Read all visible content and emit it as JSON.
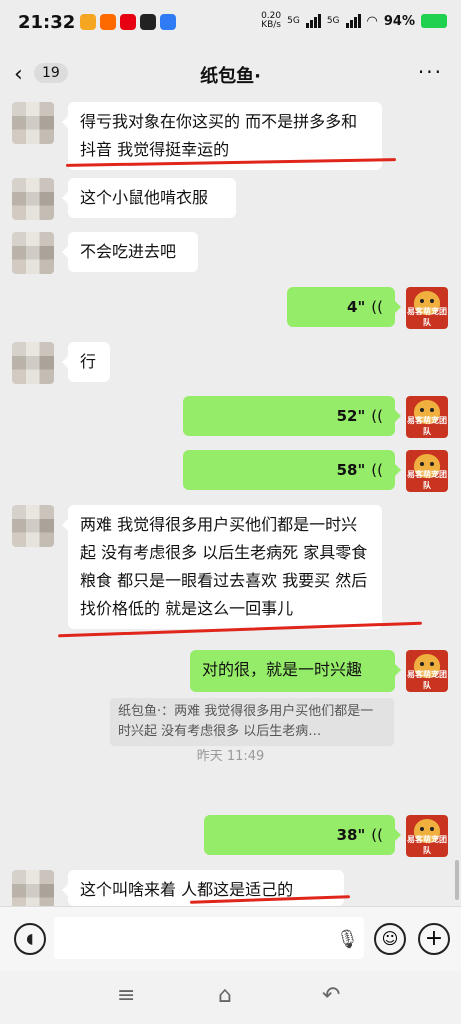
{
  "status": {
    "time": "21:32",
    "net_speed_top": "0.20",
    "net_speed_bottom": "KB/s",
    "signal1": "5G",
    "signal2": "5G",
    "battery": "94%"
  },
  "nav": {
    "back_count": "19",
    "title": "纸包鱼·"
  },
  "avatar_label": "易客萌宠团队",
  "messages": {
    "m1": "得亏我对象在你这买的  而不是拼多多和抖音   我觉得挺幸运的",
    "m2": "这个小鼠他啃衣服",
    "m3": "不会吃进去吧",
    "v1": "4\"",
    "m4": "行",
    "v2": "52\"",
    "v3": "58\"",
    "m5": "两难   我觉得很多用户买他们都是一时兴起   没有考虑很多   以后生老病死  家具零食粮食  都只是一眼看过去喜欢  我要买  然后找价格低的  就是这么一回事儿",
    "m6": "对的很，就是一时兴趣",
    "quote": "纸包鱼·：两难   我觉得很多用户买他们都是一时兴起   没有考虑很多   以后生老病…",
    "timestamp": "昨天 11:49",
    "v4": "38\"",
    "m7": "这个叫啥来着  人都这是适己的"
  },
  "icons": {
    "voice_wave": "((",
    "more": "···"
  }
}
